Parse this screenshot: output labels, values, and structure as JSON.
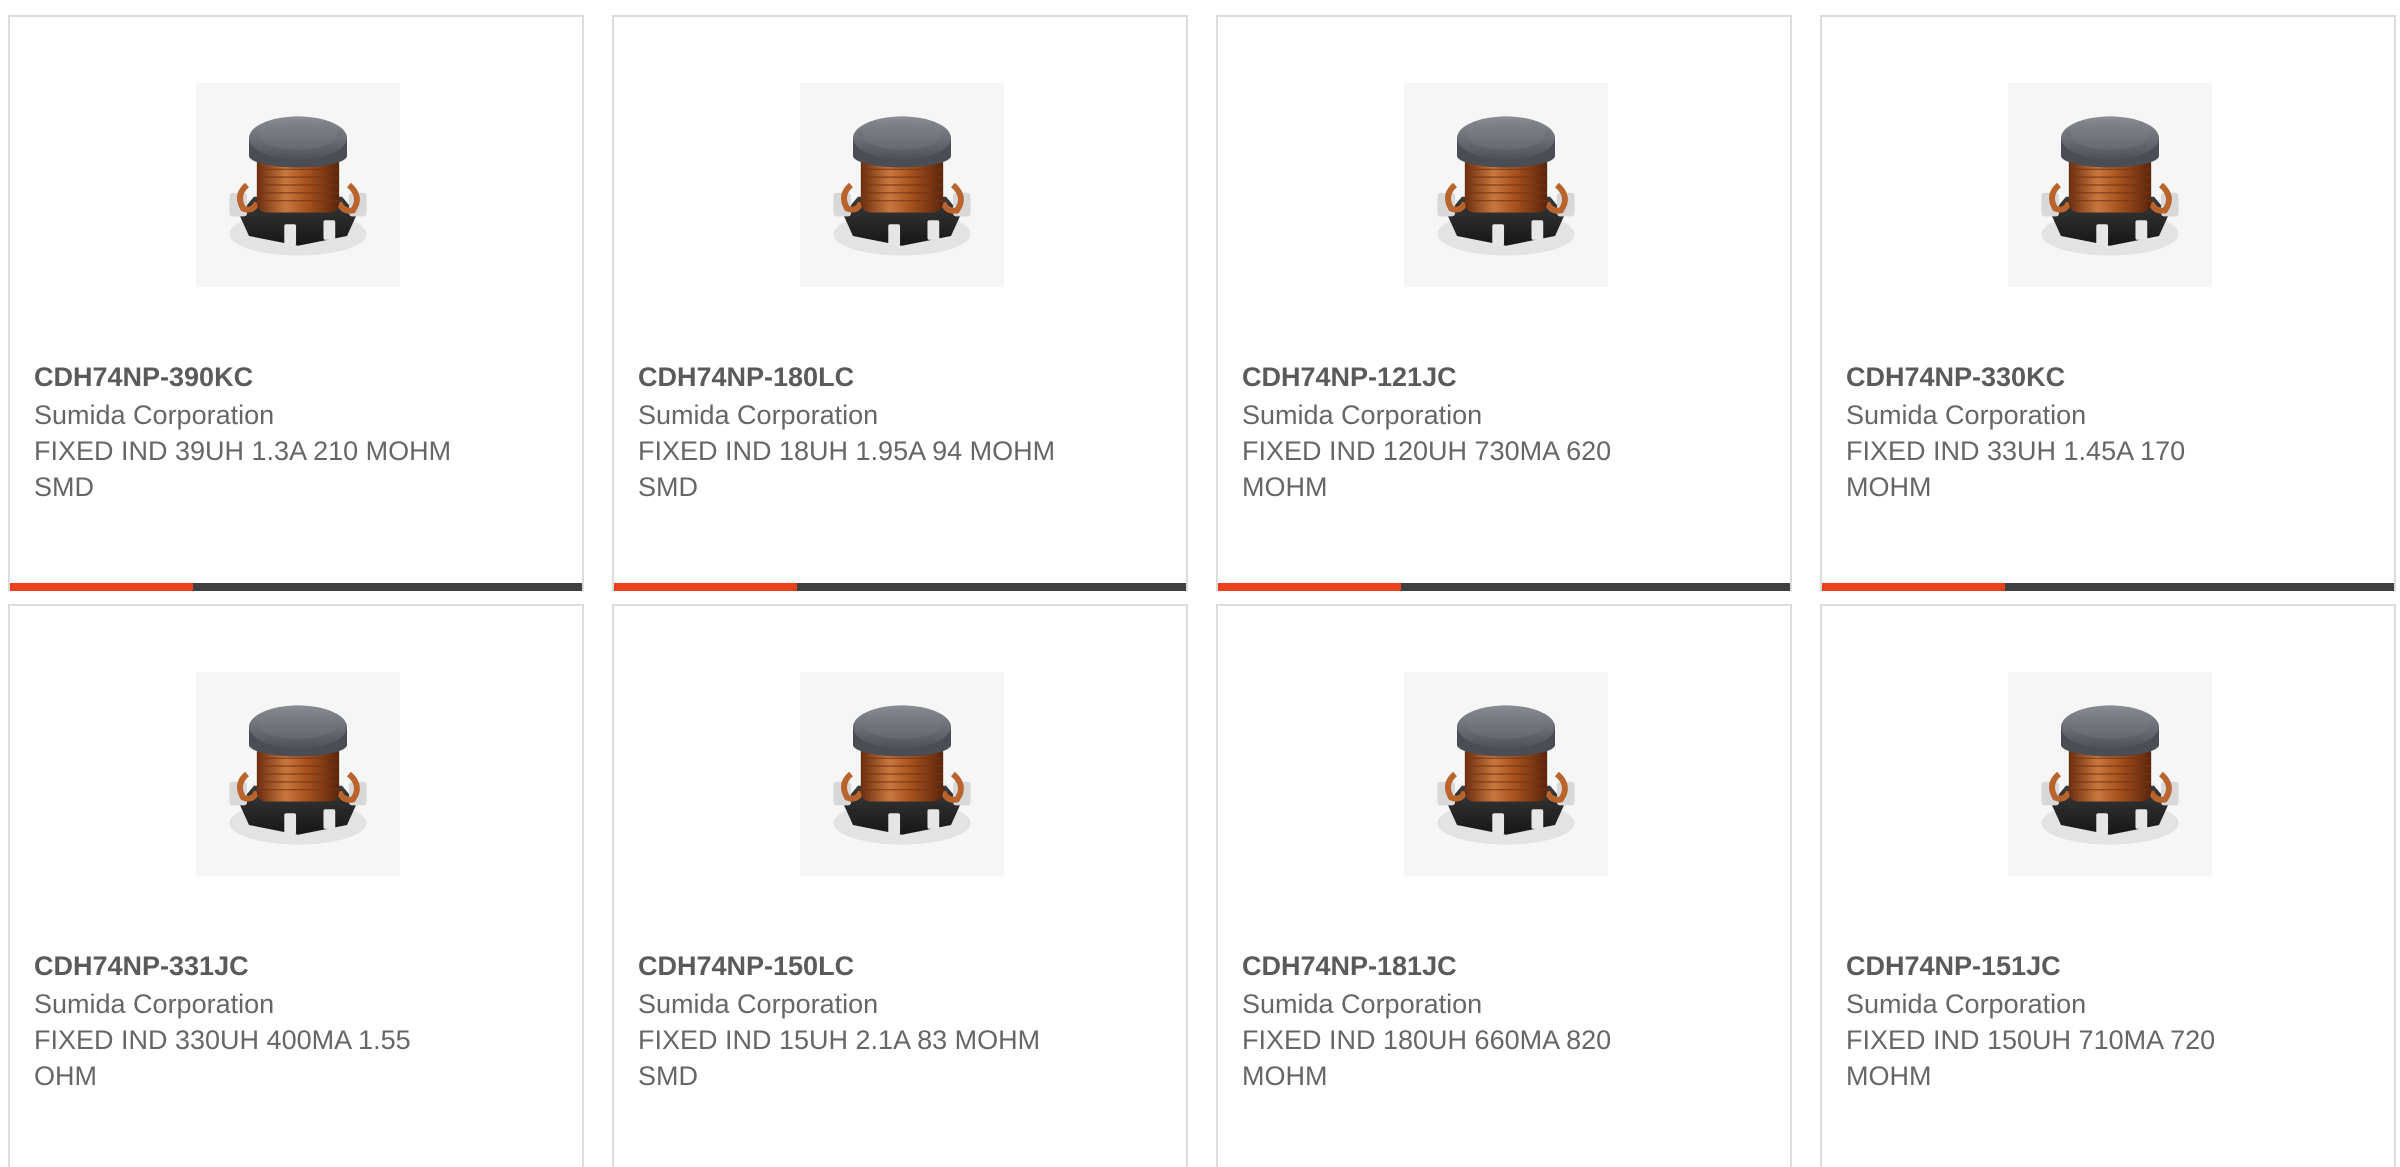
{
  "products": [
    {
      "part_number": "CDH74NP-390KC",
      "manufacturer": "Sumida Corporation",
      "description": "FIXED IND 39UH 1.3A 210 MOHM SMD",
      "image_icon": "inductor-image"
    },
    {
      "part_number": "CDH74NP-180LC",
      "manufacturer": "Sumida Corporation",
      "description": "FIXED IND 18UH 1.95A 94 MOHM SMD",
      "image_icon": "inductor-image"
    },
    {
      "part_number": "CDH74NP-121JC",
      "manufacturer": "Sumida Corporation",
      "description": "FIXED IND 120UH 730MA 620 MOHM",
      "image_icon": "inductor-image"
    },
    {
      "part_number": "CDH74NP-330KC",
      "manufacturer": "Sumida Corporation",
      "description": "FIXED IND 33UH 1.45A 170 MOHM",
      "image_icon": "inductor-image"
    },
    {
      "part_number": "CDH74NP-331JC",
      "manufacturer": "Sumida Corporation",
      "description": "FIXED IND 330UH 400MA 1.55 OHM",
      "image_icon": "inductor-image"
    },
    {
      "part_number": "CDH74NP-150LC",
      "manufacturer": "Sumida Corporation",
      "description": "FIXED IND 15UH 2.1A 83 MOHM SMD",
      "image_icon": "inductor-image"
    },
    {
      "part_number": "CDH74NP-181JC",
      "manufacturer": "Sumida Corporation",
      "description": "FIXED IND 180UH 660MA 820 MOHM",
      "image_icon": "inductor-image"
    },
    {
      "part_number": "CDH74NP-151JC",
      "manufacturer": "Sumida Corporation",
      "description": "FIXED IND 150UH 710MA 720 MOHM",
      "image_icon": "inductor-image"
    }
  ],
  "progress_fraction": 0.32,
  "colors": {
    "accent": "#e8411b",
    "bar_track": "#3f3f3f",
    "card_border": "#dcdcdc",
    "text": "#666666"
  }
}
